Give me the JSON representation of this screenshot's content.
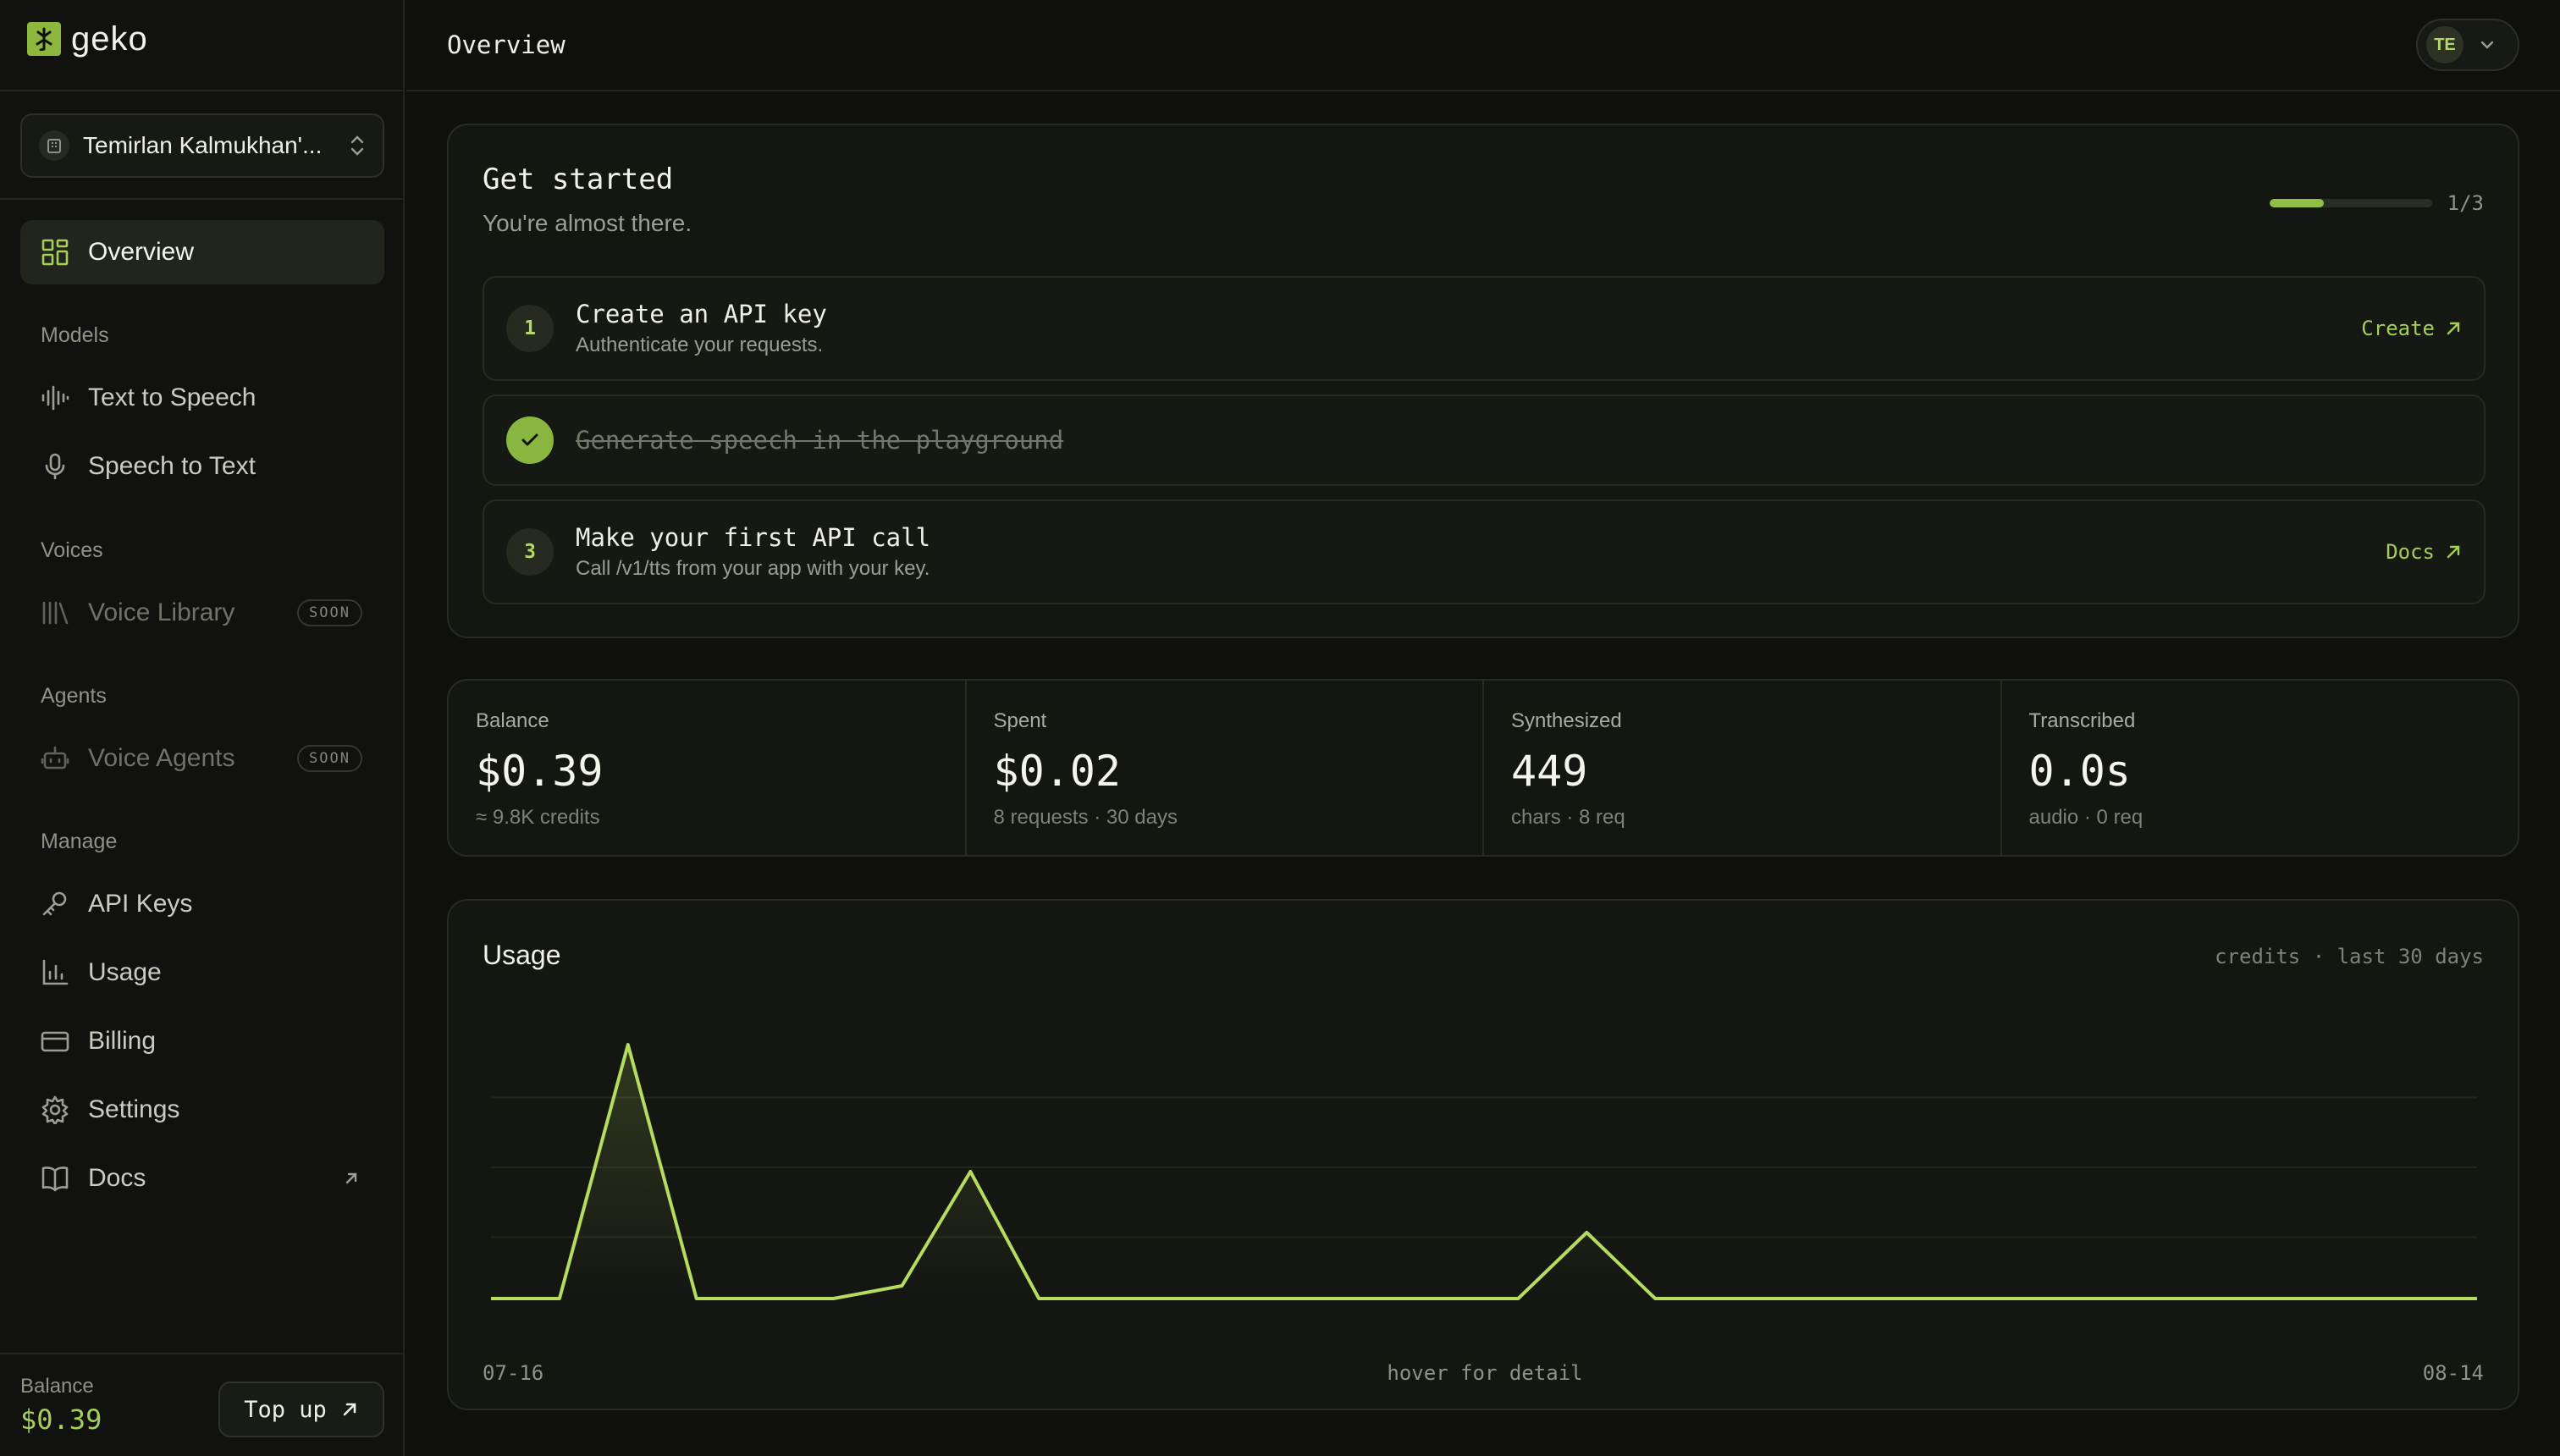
{
  "app": {
    "brand": "geko",
    "page_title": "Overview"
  },
  "workspace": {
    "name": "Temirlan Kalmukhan'..."
  },
  "sidebar": {
    "overview": "Overview",
    "sections": {
      "models": "Models",
      "voices": "Voices",
      "agents": "Agents",
      "manage": "Manage"
    },
    "models": [
      {
        "label": "Text to Speech",
        "icon": "waveform-icon"
      },
      {
        "label": "Speech to Text",
        "icon": "microphone-icon"
      }
    ],
    "voices": [
      {
        "label": "Voice Library",
        "icon": "library-icon",
        "badge": "SOON"
      }
    ],
    "agents": [
      {
        "label": "Voice Agents",
        "icon": "robot-icon",
        "badge": "SOON"
      }
    ],
    "manage": [
      {
        "label": "API Keys",
        "icon": "key-icon"
      },
      {
        "label": "Usage",
        "icon": "bar-chart-icon"
      },
      {
        "label": "Billing",
        "icon": "credit-card-icon"
      },
      {
        "label": "Settings",
        "icon": "gear-icon"
      },
      {
        "label": "Docs",
        "icon": "book-icon"
      }
    ],
    "footer": {
      "balance_label": "Balance",
      "balance_value": "$0.39",
      "topup_label": "Top up"
    }
  },
  "user": {
    "initials": "TE"
  },
  "get_started": {
    "title": "Get started",
    "subtitle": "You're almost there.",
    "progress_text": "1/3",
    "progress_fraction": 0.3333,
    "steps": [
      {
        "number": "1",
        "title": "Create an API key",
        "description": "Authenticate your requests.",
        "action": "Create",
        "done": false
      },
      {
        "number": "2",
        "title": "Generate speech in the playground",
        "description": "",
        "action": "",
        "done": true
      },
      {
        "number": "3",
        "title": "Make your first API call",
        "description": "Call /v1/tts from your app with your key.",
        "action": "Docs",
        "done": false
      }
    ]
  },
  "stats": [
    {
      "label": "Balance",
      "value": "$0.39",
      "sub": "≈ 9.8K credits"
    },
    {
      "label": "Spent",
      "value": "$0.02",
      "sub": "8 requests · 30 days"
    },
    {
      "label": "Synthesized",
      "value": "449",
      "sub": "chars · 8 req"
    },
    {
      "label": "Transcribed",
      "value": "0.0s",
      "sub": "audio · 0 req"
    }
  ],
  "usage": {
    "title": "Usage",
    "meta": "credits · last 30 days",
    "x_start": "07-16",
    "x_end": "08-14",
    "hint": "hover for detail"
  },
  "chart_data": {
    "type": "area",
    "title": "Usage",
    "x_labels": [
      "07-16",
      "08-14"
    ],
    "values": [
      0,
      0,
      1.0,
      0,
      0,
      0,
      0.05,
      0.5,
      0,
      0,
      0,
      0,
      0,
      0,
      0,
      0,
      0.26,
      0,
      0,
      0,
      0,
      0,
      0,
      0,
      0,
      0,
      0,
      0,
      0,
      0
    ],
    "ylim": [
      0,
      1.1
    ],
    "grid": true,
    "line_color": "#b5dc5f"
  },
  "colors": {
    "accent": "#a6cf58",
    "background": "#0f100d",
    "card": "#141612"
  }
}
